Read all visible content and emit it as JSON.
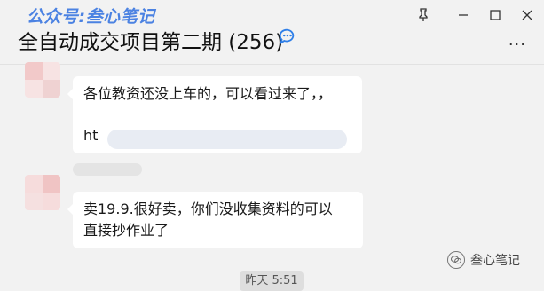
{
  "header": {
    "watermark": "公众号:叁心笔记",
    "title": "全自动成交项目第二期 (256)",
    "more": "···",
    "pin_icon": "pin-icon",
    "minimize_icon": "minimize-icon",
    "maximize_icon": "maximize-icon",
    "close_icon": "close-icon"
  },
  "messages": [
    {
      "line1": "各位教资还没上车的，可以看过来了，，",
      "link_visible": "ht"
    },
    {
      "line1": "卖19.9.很好卖，你们没收集资料的可以",
      "line2": "直接抄作业了"
    }
  ],
  "timestamp": "昨天 5:51",
  "brand": {
    "name": "叁心笔记",
    "icon": "wechat-official-account-icon"
  }
}
